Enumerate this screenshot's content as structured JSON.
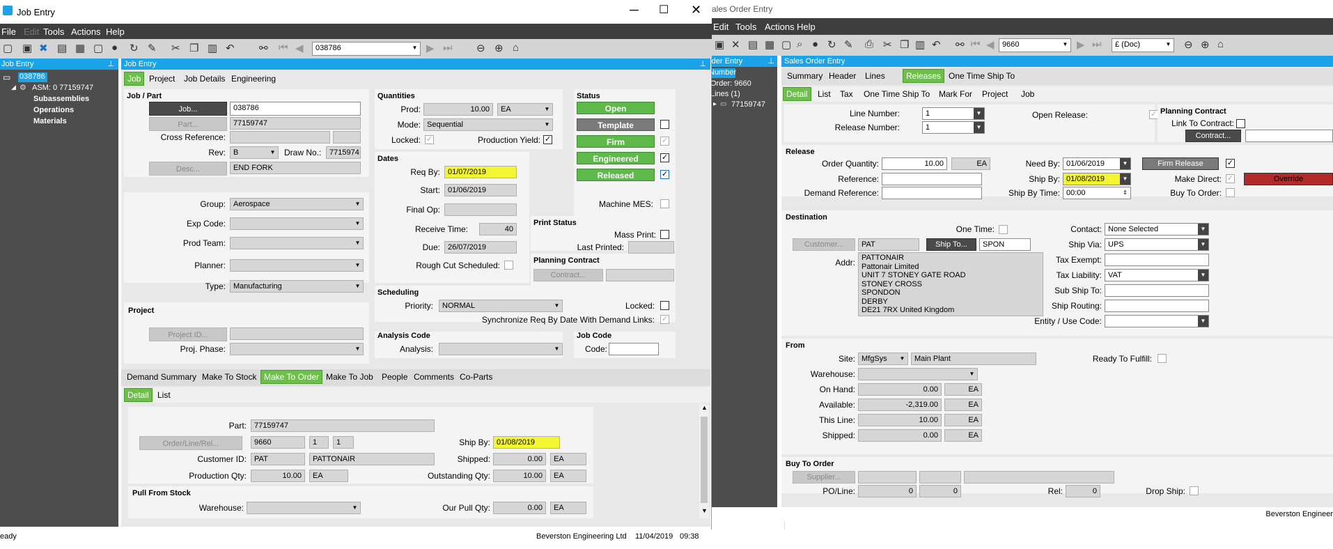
{
  "job_window": {
    "title": "Job Entry",
    "menus": [
      "File",
      "Edit",
      "Tools",
      "Actions",
      "Help"
    ],
    "toolbar_value": "038786",
    "tree_header": "Job Entry",
    "tree": {
      "root": "038786",
      "asm": "ASM: 0 77159747",
      "sub": "Subassemblies",
      "ops": "Operations",
      "mat": "Materials"
    },
    "panel_title": "Job Entry",
    "tabs": [
      "Job",
      "Project",
      "Job Details",
      "Engineering"
    ],
    "job_part": {
      "section": "Job / Part",
      "job_btn": "Job...",
      "job_val": "038786",
      "part_btn": "Part...",
      "part_val": "77159747",
      "xref_lbl": "Cross Reference:",
      "rev_lbl": "Rev:",
      "rev_val": "B",
      "draw_lbl": "Draw No.:",
      "draw_val": "7715974",
      "desc_btn": "Desc...",
      "desc_val": "END FORK"
    },
    "group": {
      "group_lbl": "Group:",
      "group_val": "Aerospace",
      "exp_lbl": "Exp Code:",
      "prod_team_lbl": "Prod Team:",
      "planner_lbl": "Planner:",
      "type_lbl": "Type:",
      "type_val": "Manufacturing"
    },
    "project": {
      "section": "Project",
      "btn": "Project ID...",
      "phase_lbl": "Proj. Phase:"
    },
    "quantities": {
      "section": "Quantities",
      "prod_lbl": "Prod:",
      "prod_val": "10.00",
      "prod_uom": "EA",
      "mode_lbl": "Mode:",
      "mode_val": "Sequential",
      "locked_lbl": "Locked:",
      "yield_lbl": "Production Yield:"
    },
    "dates": {
      "section": "Dates",
      "req_lbl": "Req By:",
      "req_val": "01/07/2019",
      "start_lbl": "Start:",
      "start_val": "01/06/2019",
      "final_lbl": "Final Op:",
      "recv_lbl": "Receive Time:",
      "recv_val": "40",
      "due_lbl": "Due:",
      "due_val": "26/07/2019",
      "rough_lbl": "Rough Cut Scheduled:"
    },
    "status": {
      "section": "Status",
      "open": "Open",
      "template": "Template",
      "firm": "Firm",
      "engineered": "Engineered",
      "released": "Released",
      "mes_lbl": "Machine MES:"
    },
    "print": {
      "section": "Print Status",
      "mass_lbl": "Mass Print:",
      "last_lbl": "Last Printed:"
    },
    "planning": {
      "section": "Planning Contract",
      "btn": "Contract..."
    },
    "scheduling": {
      "section": "Scheduling",
      "priority_lbl": "Priority:",
      "priority_val": "NORMAL",
      "locked_lbl": "Locked:",
      "sync_lbl": "Synchronize Req By Date With Demand Links:"
    },
    "analysis": {
      "section": "Analysis Code",
      "lbl": "Analysis:"
    },
    "jobcode": {
      "section": "Job Code",
      "lbl": "Code:"
    },
    "bottom_tabs": [
      "Demand Summary",
      "Make To Stock",
      "Make To Order",
      "Make To Job",
      "People",
      "Comments",
      "Co-Parts"
    ],
    "sub_tabs": [
      "Detail",
      "List"
    ],
    "mto": {
      "part_lbl": "Part:",
      "part_val": "77159747",
      "olr_btn": "Order/Line/Rel...",
      "order": "9660",
      "line": "1",
      "rel": "1",
      "ship_lbl": "Ship By:",
      "ship_val": "01/08/2019",
      "cust_lbl": "Customer ID:",
      "cust_id": "PAT",
      "cust_name": "PATTONAIR",
      "shipped_lbl": "Shipped:",
      "shipped_val": "0.00",
      "shipped_uom": "EA",
      "pq_lbl": "Production Qty:",
      "pq_val": "10.00",
      "pq_uom": "EA",
      "oq_lbl": "Outstanding Qty:",
      "oq_val": "10.00",
      "oq_uom": "EA"
    },
    "pull": {
      "section": "Pull From Stock",
      "wh_lbl": "Warehouse:",
      "our_lbl": "Our Pull Qty:",
      "our_val": "0.00",
      "our_uom": "EA"
    },
    "status_bar": {
      "left": "eady",
      "company": "Beverston Engineering Ltd",
      "date": "11/04/2019",
      "time": "09:38"
    }
  },
  "so_window": {
    "title": "ales Order Entry",
    "menus": [
      "Edit",
      "Tools",
      "Actions",
      "Help"
    ],
    "toolbar_value": "9660",
    "currency": "£ (Doc)",
    "tree_header": "rder Entry",
    "tree": {
      "number": "Number",
      "order": "Order: 9660",
      "lines": "Lines (1)",
      "item": "77159747"
    },
    "panel_title": "Sales Order Entry",
    "tabs": [
      "Summary",
      "Header",
      "Lines",
      "Releases",
      "One Time Ship To"
    ],
    "sub_tabs": [
      "Detail",
      "List",
      "Tax",
      "One Time Ship To",
      "Mark For",
      "Project",
      "Job"
    ],
    "line_lbl": "Line Number:",
    "line_val": "1",
    "rel_lbl": "Release Number:",
    "rel_val": "1",
    "open_lbl": "Open Release:",
    "pc": {
      "section": "Planning Contract",
      "link_lbl": "Link To Contract:",
      "btn": "Contract..."
    },
    "release": {
      "section": "Release",
      "oq_lbl": "Order Quantity:",
      "oq_val": "10.00",
      "oq_uom": "EA",
      "ref_lbl": "Reference:",
      "dref_lbl": "Demand Reference:",
      "need_lbl": "Need By:",
      "need_val": "01/06/2019",
      "ship_lbl": "Ship By:",
      "ship_val": "01/08/2019",
      "sbt_lbl": "Ship By Time:",
      "sbt_val": "00:00",
      "firm_btn": "Firm Release",
      "make_lbl": "Make Direct:",
      "override_btn": "Override",
      "buy_lbl": "Buy To Order:"
    },
    "dest": {
      "section": "Destination",
      "onetime_lbl": "One Time:",
      "cust_btn": "Customer...",
      "cust_val": "PAT",
      "shipto_btn": "Ship To...",
      "shipto_val": "SPON",
      "addr_lbl": "Addr:",
      "addr": [
        "PATTONAIR",
        "Pattonair Limited",
        "UNIT 7 STONEY GATE ROAD",
        "STONEY CROSS",
        "SPONDON",
        "DERBY",
        "DE21 7RX    United Kingdom"
      ],
      "contact_lbl": "Contact:",
      "contact_val": "None Selected",
      "via_lbl": "Ship Via:",
      "via_val": "UPS",
      "taxex_lbl": "Tax Exempt:",
      "taxl_lbl": "Tax Liability:",
      "taxl_val": "VAT",
      "subship_lbl": "Sub Ship To:",
      "routing_lbl": "Ship Routing:",
      "entity_lbl": "Entity / Use Code:"
    },
    "from": {
      "section": "From",
      "site_lbl": "Site:",
      "site_val": "MfgSys",
      "site_name": "Main Plant",
      "wh_lbl": "Warehouse:",
      "ready_lbl": "Ready To Fulfill:",
      "onhand_lbl": "On Hand:",
      "onhand_val": "0.00",
      "avail_lbl": "Available:",
      "avail_val": "-2,319.00",
      "thisline_lbl": "This Line:",
      "thisline_val": "10.00",
      "shipped_lbl": "Shipped:",
      "shipped_val": "0.00",
      "uom": "EA"
    },
    "bto": {
      "section": "Buy To Order",
      "supplier_btn": "Supplier...",
      "po_lbl": "PO/Line:",
      "po_val": "0",
      "line_val": "0",
      "rel_lbl": "Rel:",
      "rel_val": "0",
      "drop_lbl": "Drop Ship:"
    },
    "status_company": "Beverston Engineer"
  },
  "colors": {
    "accent_blue": "#1aa3e8",
    "green": "#6cc04a",
    "highlight": "#f4f532",
    "dark_gray": "#4a4a4a",
    "override_red": "#b22a2a"
  }
}
